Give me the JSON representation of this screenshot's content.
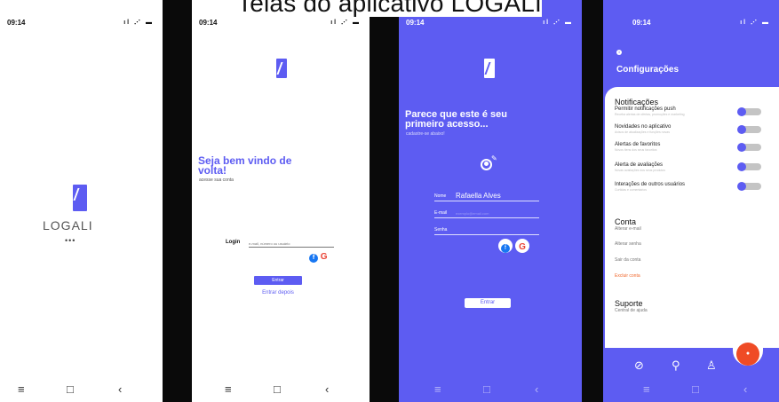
{
  "heading": "Telas do aplicativo LOGALI",
  "status": {
    "time": "09:14",
    "icons": "ıl ⋰ ▬"
  },
  "splash": {
    "brand": "LOGALI",
    "dots": "•••"
  },
  "login": {
    "welcome_title": "Seja bem vindo de volta!",
    "welcome_sub": "acesse sua conta",
    "login_label": "Login",
    "login_placeholder": "e-mail, número ou usuário",
    "enter_button": "Entrar",
    "later_button": "Entrar depois"
  },
  "signup": {
    "title": "Parece que este é seu primeiro acesso...",
    "subtitle": "cadastre-se abaixo!",
    "fields": [
      {
        "label": "Nome",
        "value": "Rafaella Alves"
      },
      {
        "label": "E-mail",
        "placeholder": "exemplo@email.com"
      },
      {
        "label": "Senha",
        "placeholder": ""
      }
    ],
    "enter_button": "Entrar"
  },
  "settings": {
    "title": "Configurações",
    "notifications_header": "Notificações",
    "items": [
      {
        "label": "Permitir notificações push",
        "desc": "Receba alertas de ofertas, promoções e marketing"
      },
      {
        "label": "Novidades no aplicativo",
        "desc": "Avisos de atualizações e funções novas"
      },
      {
        "label": "Alertas de favoritos",
        "desc": "Novos itens dos seus favoritos"
      },
      {
        "label": "Alerta de avaliações",
        "desc": "Novas avaliações dos seus produtos"
      },
      {
        "label": "Interações de outros usuários",
        "desc": "Curtidas e comentários"
      }
    ],
    "account_header": "Conta",
    "account_links": [
      "Alterar e-mail",
      "Alterar senha",
      "Sair da conta"
    ],
    "delete_account": "Excluir conta",
    "support_header": "Suporte",
    "support_link": "Central de ajuda"
  },
  "nav": {
    "menu": "≡",
    "home": "□",
    "back": "‹"
  },
  "colors": {
    "primary": "#5d5cf2",
    "danger": "#f0662a"
  }
}
